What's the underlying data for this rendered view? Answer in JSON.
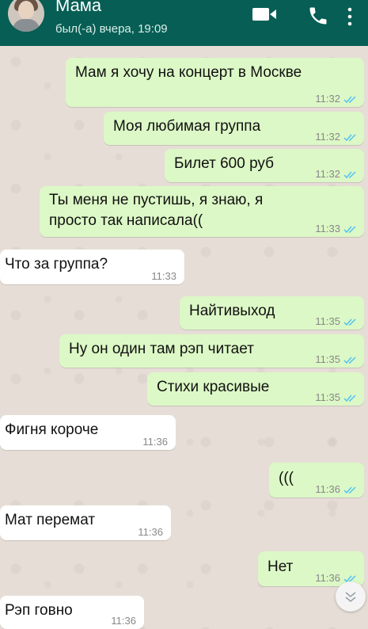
{
  "header": {
    "contact_name": "Мама",
    "status": "был(-а) вчера, 19:09"
  },
  "messages": [
    {
      "dir": "out",
      "text": "Мам я хочу на концерт в Москве",
      "time": "11:32"
    },
    {
      "dir": "out",
      "text": "Моя любимая группа",
      "time": "11:32"
    },
    {
      "dir": "out",
      "text": "Билет 600 руб",
      "time": "11:32"
    },
    {
      "dir": "out",
      "text_line1": "Ты меня не пустишь, я знаю, я",
      "text_line2": "просто так написала((",
      "time": "11:33"
    },
    {
      "dir": "in",
      "text": "Что за группа?",
      "time": "11:33"
    },
    {
      "dir": "out",
      "text": "Найтивыход",
      "time": "11:35"
    },
    {
      "dir": "out",
      "text": "Ну он один там рэп читает",
      "time": "11:35"
    },
    {
      "dir": "out",
      "text": "Стихи красивые",
      "time": "11:35"
    },
    {
      "dir": "in",
      "text": "Фигня короче",
      "time": "11:36"
    },
    {
      "dir": "out",
      "text": "(((",
      "time": "11:36"
    },
    {
      "dir": "in",
      "text": "Мат перемат",
      "time": "11:36"
    },
    {
      "dir": "out",
      "text": "Нет",
      "time": "11:36"
    },
    {
      "dir": "in",
      "text": "Рэп говно",
      "time": "11:36"
    }
  ],
  "icons": {
    "video_call": "video-camera-icon",
    "voice_call": "phone-icon",
    "read_receipt": "double-check-icon",
    "scroll_down": "chevron-down-icon"
  },
  "colors": {
    "header": "#075e54",
    "outgoing_bubble": "#dcf8c6",
    "incoming_bubble": "#ffffff",
    "read_tick": "#4fc3f7"
  }
}
